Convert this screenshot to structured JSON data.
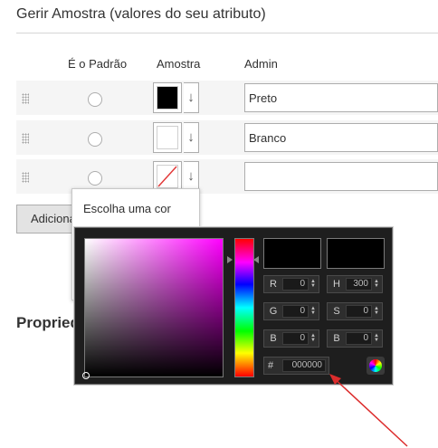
{
  "section": {
    "title": "Gerir Amostra (valores do seu atributo)"
  },
  "columns": {
    "default": "É o Padrão",
    "swatch": "Amostra",
    "admin": "Admin"
  },
  "rows": [
    {
      "swatch_color": "#000000",
      "admin_value": "Preto"
    },
    {
      "swatch_color": "#ffffff",
      "admin_value": "Branco"
    },
    {
      "swatch_color": "none",
      "admin_value": ""
    }
  ],
  "swatch_arrow_glyph": "↓",
  "add_button": {
    "label": "Adicionar"
  },
  "properties": {
    "title": "Propriedades"
  },
  "tooltip": {
    "text": "Escolha uma cor"
  },
  "color_picker": {
    "hue_color": "#ff00ff",
    "rgb": {
      "r_label": "R",
      "r": "0",
      "g_label": "G",
      "g": "0",
      "b_label": "B",
      "b": "0"
    },
    "hsb": {
      "h_label": "H",
      "h": "300",
      "s_label": "S",
      "s": "0",
      "b_label": "B",
      "b": "0"
    },
    "hex_label": "#",
    "hex": "000000",
    "spin_glyph": "▲▼"
  },
  "colors": {
    "annotation_arrow": "#dc2c2c"
  }
}
